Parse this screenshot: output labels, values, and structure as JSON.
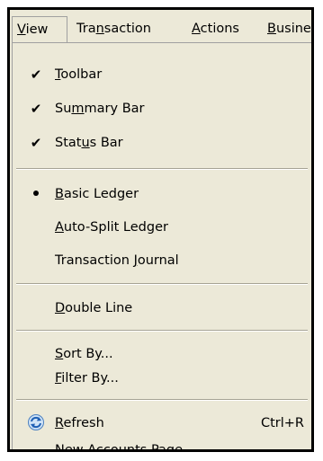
{
  "menubar": {
    "items": [
      {
        "label": "View",
        "accel": "V"
      },
      {
        "label": "Transaction",
        "accel": "n"
      },
      {
        "label": "Actions",
        "accel": "A"
      },
      {
        "label": "Busines",
        "accel": "B"
      }
    ]
  },
  "view_menu": {
    "items": [
      {
        "label": "Toolbar",
        "mark": "check",
        "checked": true
      },
      {
        "label": "Summary Bar",
        "mark": "check",
        "checked": true
      },
      {
        "label": "Status Bar",
        "mark": "check",
        "checked": true
      },
      {
        "label": "Basic Ledger",
        "mark": "bullet",
        "selected": true
      },
      {
        "label": "Auto-Split Ledger"
      },
      {
        "label": "Transaction Journal"
      },
      {
        "label": "Double Line"
      },
      {
        "label": "Sort By..."
      },
      {
        "label": "Filter By..."
      },
      {
        "label": "Refresh",
        "icon": "refresh-icon",
        "shortcut": "Ctrl+R"
      },
      {
        "label": "New Accounts Page"
      }
    ]
  },
  "colors": {
    "menu_background": "#ece9d8",
    "frame_border": "#000000"
  }
}
